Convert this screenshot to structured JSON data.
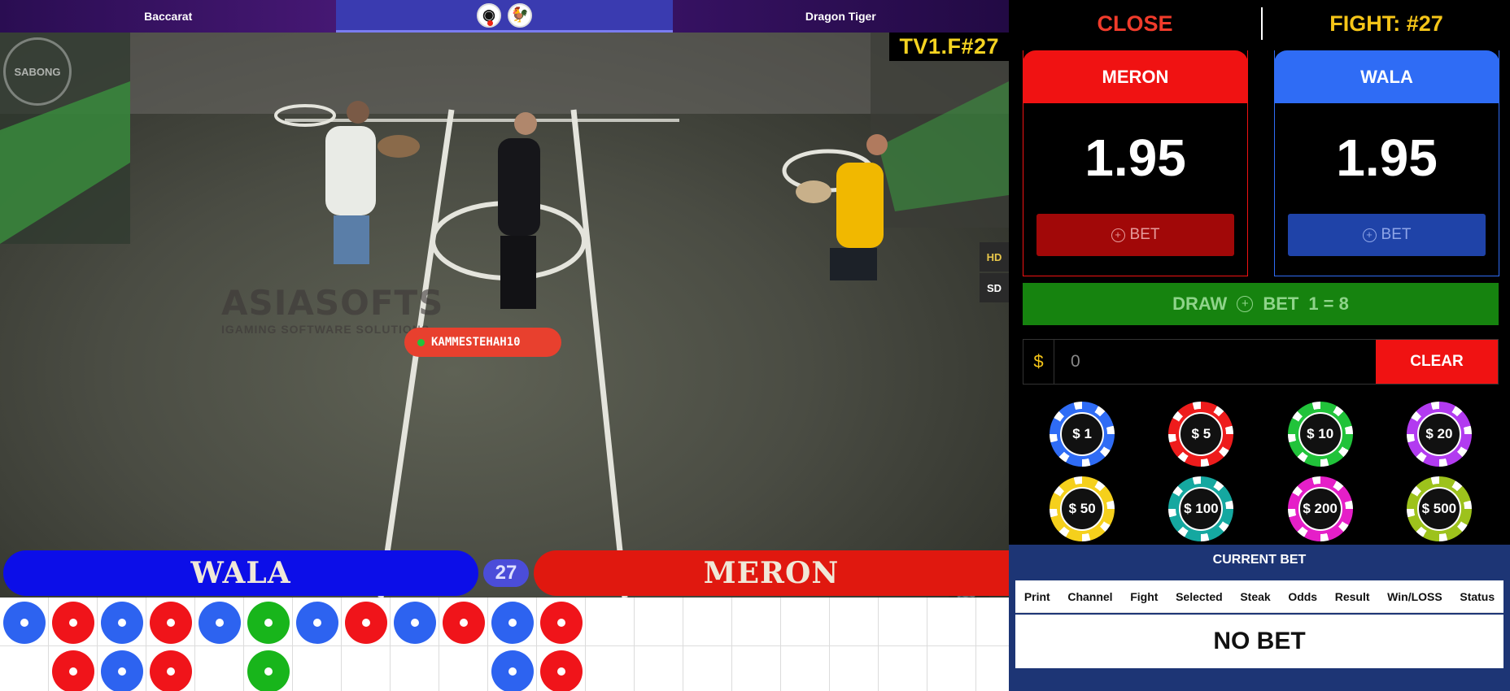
{
  "topnav": {
    "left_tab": "Baccarat",
    "right_tab": "Dragon Tiger"
  },
  "video": {
    "channel_label": "TV1.F#27",
    "quality_hd": "HD",
    "quality_sd": "SD",
    "watermark_title": "ASIASOFTS",
    "watermark_sub": "IGAMING SOFTWARE SOLUTIONS",
    "username": "KAMMESTEHAH10",
    "logo_text": "SABONG",
    "banner_left": "WALA",
    "banner_right": "MERON",
    "fight_number": "27",
    "icons": [
      "pause-icon",
      "volume-icon",
      "rooster-icon"
    ]
  },
  "bead_road": {
    "colors": {
      "blue": "#2d63f0",
      "red": "#f0141a",
      "green": "#18b51b"
    },
    "row1": [
      "blue",
      "red",
      "blue",
      "red",
      "blue",
      "green",
      "blue",
      "red",
      "blue",
      "red",
      "blue",
      "red",
      "",
      "",
      "",
      "",
      "",
      "",
      "",
      "",
      ""
    ],
    "row2": [
      "",
      "red",
      "blue",
      "red",
      "",
      "green",
      "",
      "",
      "",
      "",
      "blue",
      "red",
      "",
      "",
      "",
      "",
      "",
      "",
      "",
      "",
      ""
    ]
  },
  "panel": {
    "close_label": "CLOSE",
    "fight_label": "FIGHT: #27",
    "meron": {
      "title": "MERON",
      "odds": "1.95",
      "bet_label": "BET",
      "color": "#f01212"
    },
    "wala": {
      "title": "WALA",
      "odds": "1.95",
      "bet_label": "BET",
      "color": "#2f6cf5"
    },
    "draw": {
      "label": "DRAW",
      "bet_label": "BET",
      "ratio": "1 = 8"
    },
    "amount": {
      "currency": "$",
      "value": "0",
      "clear_label": "CLEAR"
    },
    "chips": [
      {
        "label": "$ 1",
        "color": "#2f6cf5"
      },
      {
        "label": "$ 5",
        "color": "#ee1c1c"
      },
      {
        "label": "$ 10",
        "color": "#21c33a"
      },
      {
        "label": "$ 20",
        "color": "#b23bf0"
      },
      {
        "label": "$ 50",
        "color": "#f5d01c"
      },
      {
        "label": "$ 100",
        "color": "#15a8a0"
      },
      {
        "label": "$ 200",
        "color": "#e51fc8"
      },
      {
        "label": "$ 500",
        "color": "#9dc21c"
      }
    ],
    "current_bet": {
      "title": "CURRENT BET",
      "columns": [
        "Print",
        "Channel",
        "Fight",
        "Selected",
        "Steak",
        "Odds",
        "Result",
        "Win/LOSS",
        "Status"
      ],
      "empty_text": "NO BET"
    }
  }
}
